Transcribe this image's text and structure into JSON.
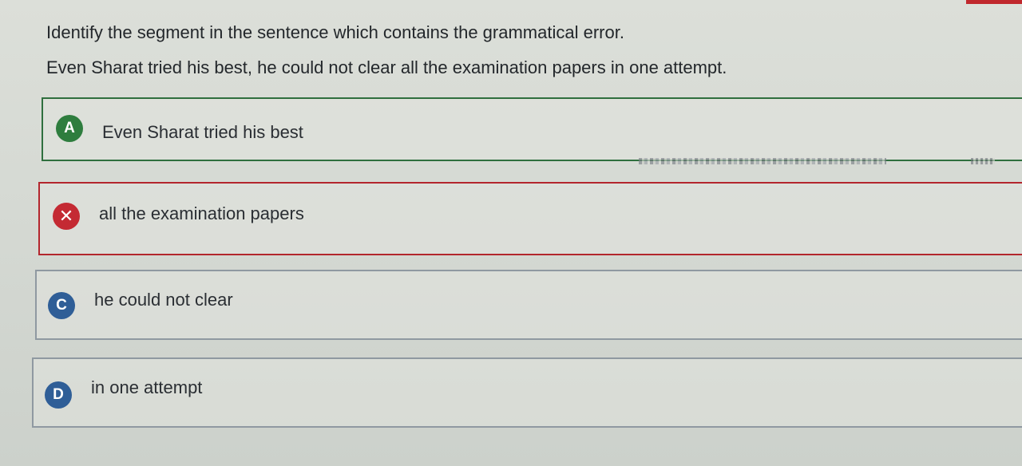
{
  "question": {
    "prompt": "Identify the segment in the sentence which contains the grammatical error.",
    "sentence": "Even Sharat tried his best, he could not clear all the examination papers in one attempt."
  },
  "options": [
    {
      "badge": "A",
      "text": "Even Sharat tried his best",
      "state": "correct",
      "badge_color": "#2e7d3e"
    },
    {
      "badge": "✕",
      "text": "all the examination papers",
      "state": "wrong",
      "badge_color": "#c42a33"
    },
    {
      "badge": "C",
      "text": "he could not clear",
      "state": "neutral",
      "badge_color": "#2f5e97"
    },
    {
      "badge": "D",
      "text": "in one attempt",
      "state": "neutral",
      "badge_color": "#2f5e97"
    }
  ],
  "colors": {
    "correct_border": "#2f6f3e",
    "wrong_border": "#b3262d",
    "neutral_border": "#8f99a1",
    "accent_top": "#c0282d"
  }
}
